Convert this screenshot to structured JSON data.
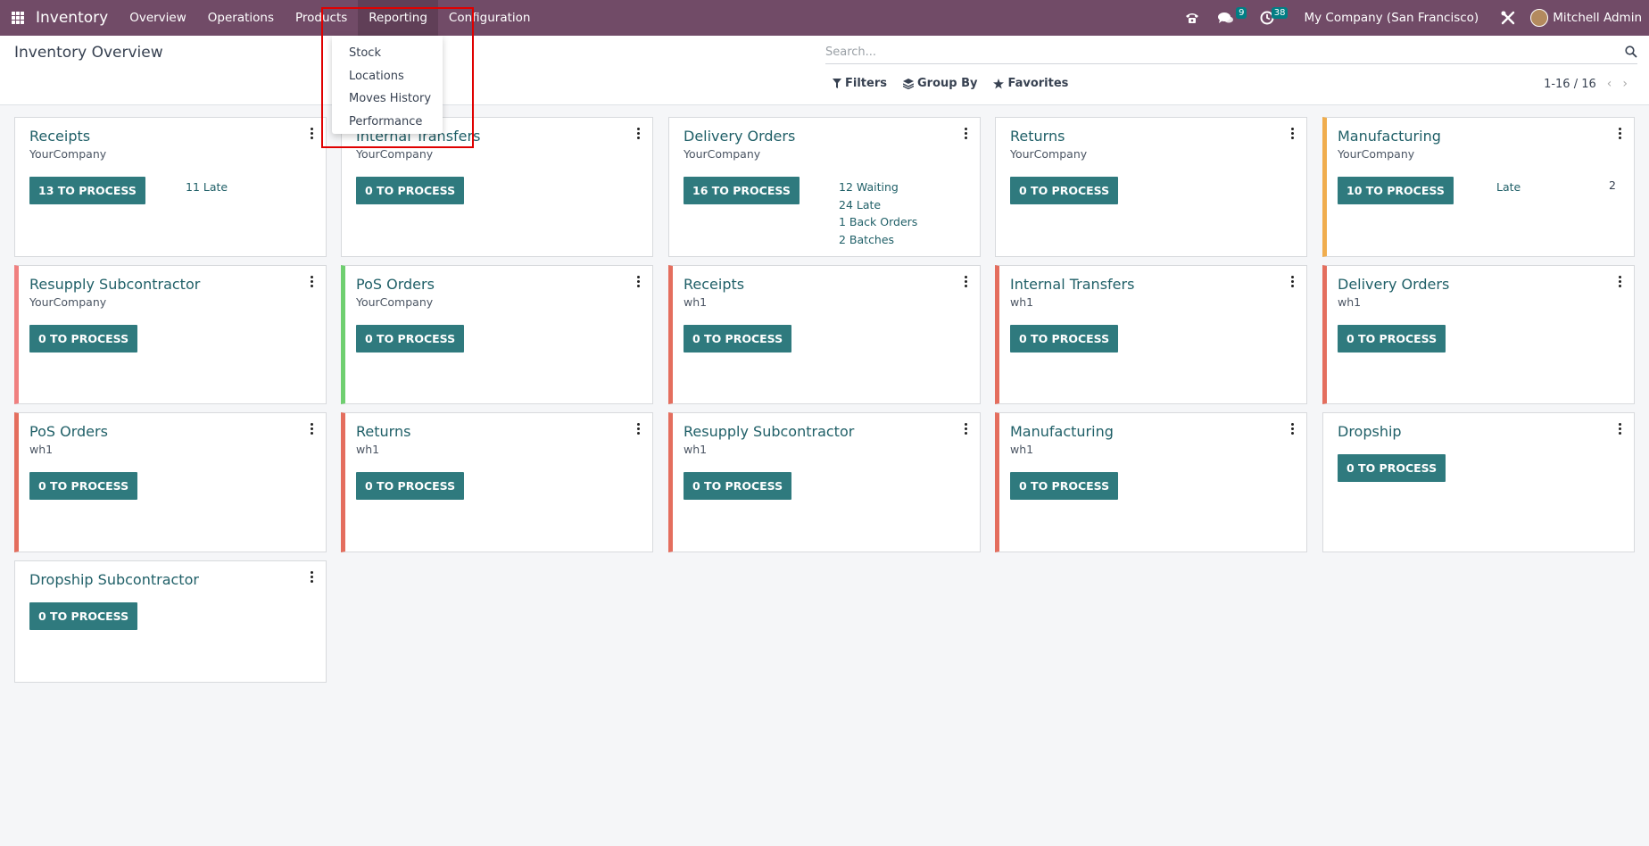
{
  "navbar": {
    "brand": "Inventory",
    "menu": [
      "Overview",
      "Operations",
      "Products",
      "Reporting",
      "Configuration"
    ],
    "messages_badge": "9",
    "activities_badge": "38",
    "company": "My Company (San Francisco)",
    "user": "Mitchell Admin"
  },
  "control_panel": {
    "title": "Inventory Overview",
    "search_placeholder": "Search...",
    "filters": "Filters",
    "group_by": "Group By",
    "favorites": "Favorites",
    "pager": "1-16 / 16"
  },
  "reporting_menu": [
    "Stock",
    "Locations",
    "Moves History",
    "Performance"
  ],
  "cards": [
    {
      "title": "Receipts",
      "subtitle": "YourCompany",
      "button": "13 TO PROCESS",
      "stats": [
        "11 Late"
      ]
    },
    {
      "title": "Internal Transfers",
      "subtitle": "YourCompany",
      "button": "0 TO PROCESS",
      "stats": []
    },
    {
      "title": "Delivery Orders",
      "subtitle": "YourCompany",
      "button": "16 TO PROCESS",
      "stats": [
        "12 Waiting",
        "24 Late",
        "1 Back Orders",
        "2 Batches"
      ]
    },
    {
      "title": "Returns",
      "subtitle": "YourCompany",
      "button": "0 TO PROCESS",
      "stats": []
    },
    {
      "title": "Manufacturing",
      "subtitle": "YourCompany",
      "button": "10 TO PROCESS",
      "stats": [
        "Late"
      ],
      "stat_value": "2"
    },
    {
      "title": "Resupply Subcontractor",
      "subtitle": "YourCompany",
      "button": "0 TO PROCESS",
      "stats": []
    },
    {
      "title": "PoS Orders",
      "subtitle": "YourCompany",
      "button": "0 TO PROCESS",
      "stats": []
    },
    {
      "title": "Receipts",
      "subtitle": "wh1",
      "button": "0 TO PROCESS",
      "stats": []
    },
    {
      "title": "Internal Transfers",
      "subtitle": "wh1",
      "button": "0 TO PROCESS",
      "stats": []
    },
    {
      "title": "Delivery Orders",
      "subtitle": "wh1",
      "button": "0 TO PROCESS",
      "stats": []
    },
    {
      "title": "PoS Orders",
      "subtitle": "wh1",
      "button": "0 TO PROCESS",
      "stats": []
    },
    {
      "title": "Returns",
      "subtitle": "wh1",
      "button": "0 TO PROCESS",
      "stats": []
    },
    {
      "title": "Resupply Subcontractor",
      "subtitle": "wh1",
      "button": "0 TO PROCESS",
      "stats": []
    },
    {
      "title": "Manufacturing",
      "subtitle": "wh1",
      "button": "0 TO PROCESS",
      "stats": []
    },
    {
      "title": "Dropship",
      "subtitle": "",
      "button": "0 TO PROCESS",
      "stats": []
    },
    {
      "title": "Dropship Subcontractor",
      "subtitle": "",
      "button": "0 TO PROCESS",
      "stats": []
    }
  ],
  "colors": {
    "navbar": "#714b67",
    "button": "#2f7a7e",
    "link": "#1f5f67",
    "late_border": "#e46e5e",
    "pos_border": "#6fcf70",
    "warning_border": "#f0ad4e",
    "highlight": "#e00000"
  }
}
